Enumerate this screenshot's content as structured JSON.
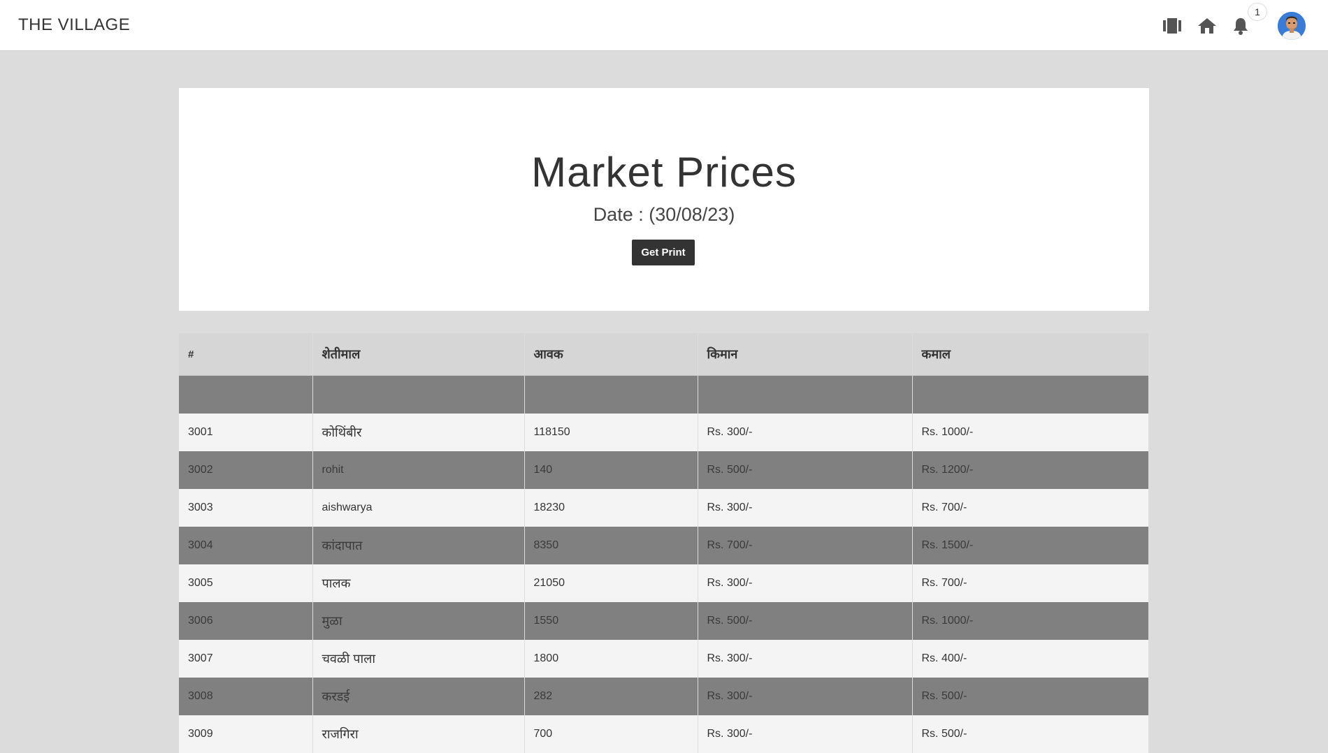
{
  "app": {
    "brand": "THE VILLAGE"
  },
  "header_icons": {
    "gallery": "gallery-icon",
    "home": "home-icon",
    "bell": "bell-icon",
    "notification_count": "1",
    "avatar": "user-avatar"
  },
  "hero": {
    "title": "Market Prices",
    "date": "Date : (30/08/23)",
    "print_label": "Get Print"
  },
  "table": {
    "headers": [
      "#",
      "शेतीमाल",
      "आवक",
      "किमान",
      "कमाल"
    ],
    "rows": [
      [
        "3001",
        "कोथिंबीर",
        "118150",
        "Rs. 300/-",
        "Rs. 1000/-"
      ],
      [
        "3002",
        "rohit",
        "140",
        "Rs. 500/-",
        "Rs. 1200/-"
      ],
      [
        "3003",
        "aishwarya",
        "18230",
        "Rs. 300/-",
        "Rs. 700/-"
      ],
      [
        "3004",
        "कांदापात",
        "8350",
        "Rs. 700/-",
        "Rs. 1500/-"
      ],
      [
        "3005",
        "पालक",
        "21050",
        "Rs. 300/-",
        "Rs. 700/-"
      ],
      [
        "3006",
        "मुळा",
        "1550",
        "Rs. 500/-",
        "Rs. 1000/-"
      ],
      [
        "3007",
        "चवळी पाला",
        "1800",
        "Rs. 300/-",
        "Rs. 400/-"
      ],
      [
        "3008",
        "करडई",
        "282",
        "Rs. 300/-",
        "Rs. 500/-"
      ],
      [
        "3009",
        "राजगिरा",
        "700",
        "Rs. 300/-",
        "Rs. 500/-"
      ]
    ]
  },
  "colors": {
    "page_bg": "#dcdcdc",
    "header_row": "#d6d6d6",
    "row_light": "#f4f4f4",
    "row_dark": "#808080",
    "button": "#333333"
  }
}
